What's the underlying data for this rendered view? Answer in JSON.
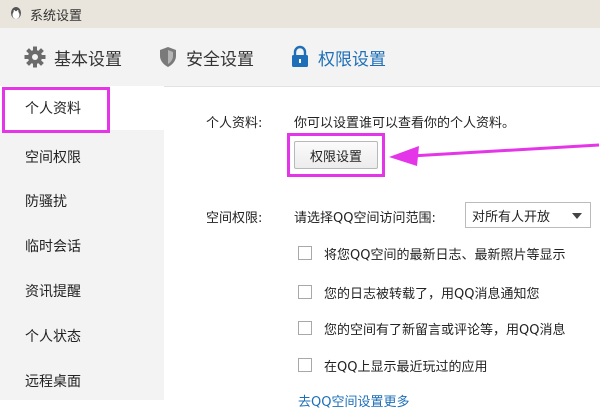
{
  "window": {
    "title": "系统设置"
  },
  "tabs": [
    {
      "label": "基本设置",
      "icon": "gear-icon"
    },
    {
      "label": "安全设置",
      "icon": "shield-icon"
    },
    {
      "label": "权限设置",
      "icon": "lock-icon",
      "active": true
    }
  ],
  "sidebar": {
    "items": [
      {
        "label": "个人资料",
        "active": true
      },
      {
        "label": "空间权限"
      },
      {
        "label": "防骚扰"
      },
      {
        "label": "临时会话"
      },
      {
        "label": "资讯提醒"
      },
      {
        "label": "个人状态"
      },
      {
        "label": "远程桌面"
      }
    ]
  },
  "profile": {
    "label": "个人资料:",
    "description": "你可以设置谁可以查看你的个人资料。",
    "button_label": "权限设置"
  },
  "space": {
    "label": "空间权限:",
    "prompt": "请选择QQ空间访问范围:",
    "selected": "对所有人开放",
    "options": [
      "将您QQ空间的最新日志、最新照片等显示",
      "您的日志被转载了，用QQ消息通知您",
      "您的空间有了新留言或评论等，用QQ消息",
      "在QQ上显示最近玩过的应用"
    ],
    "more_link": "去QQ空间设置更多"
  },
  "colors": {
    "accent": "#1e6fb8",
    "highlight": "#e535e8"
  }
}
